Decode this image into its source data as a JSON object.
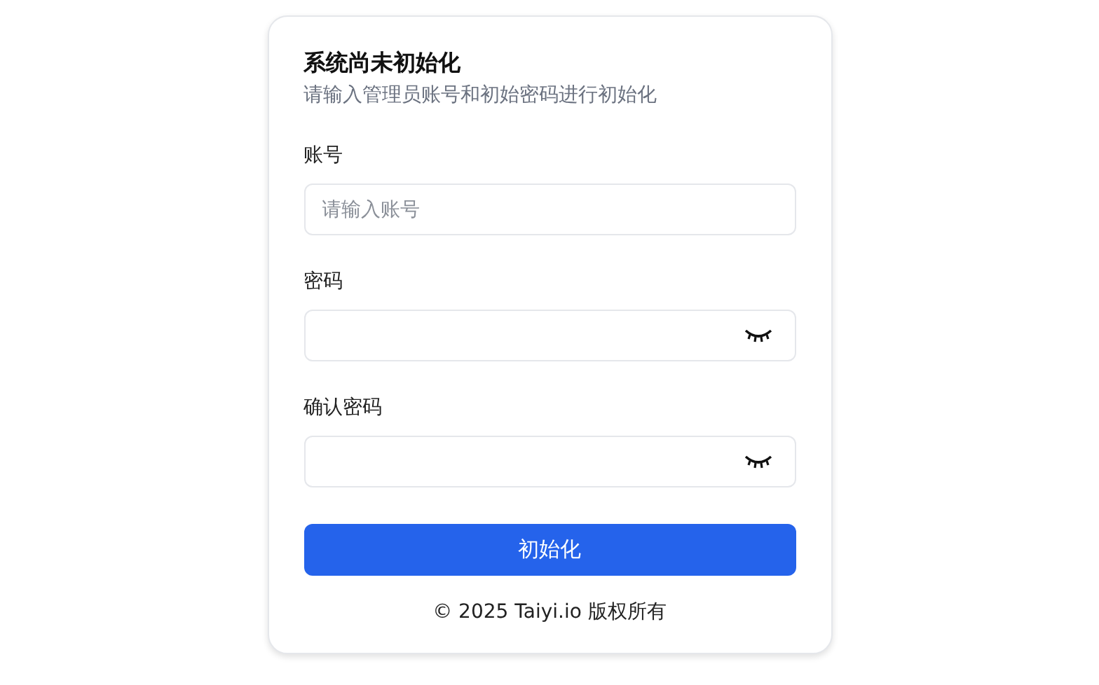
{
  "card": {
    "title": "系统尚未初始化",
    "subtitle": "请输入管理员账号和初始密码进行初始化"
  },
  "fields": [
    {
      "kind": "text",
      "label": "账号",
      "placeholder": "请输入账号"
    },
    {
      "kind": "password",
      "label": "密码",
      "revealed": false
    },
    {
      "kind": "password",
      "label": "确认密码",
      "revealed": false
    }
  ],
  "submit_button": "初始化",
  "footer": "© 2025 Taiyi.io 版权所有"
}
